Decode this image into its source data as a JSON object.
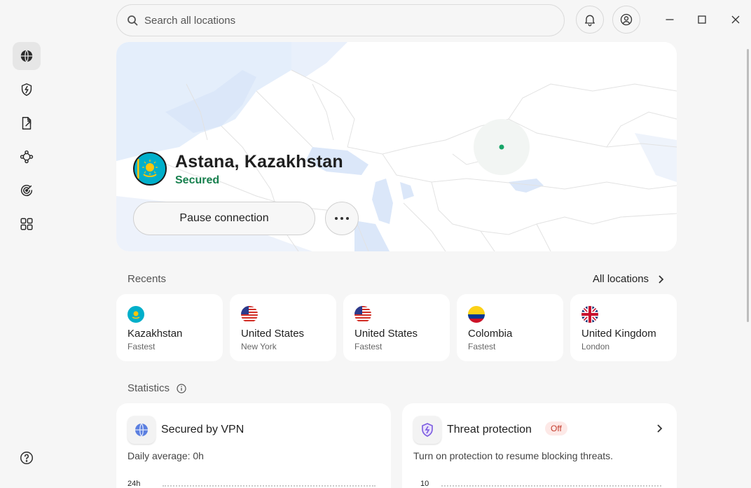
{
  "search": {
    "placeholder": "Search all locations"
  },
  "connection": {
    "location": "Astana, Kazakhstan",
    "status": "Secured",
    "pause_label": "Pause connection"
  },
  "recents": {
    "label": "Recents",
    "all_locations_label": "All locations",
    "items": [
      {
        "name": "Kazakhstan",
        "sub": "Fastest",
        "flag": "kazakhstan-flag"
      },
      {
        "name": "United States",
        "sub": "New York",
        "flag": "us-flag"
      },
      {
        "name": "United States",
        "sub": "Fastest",
        "flag": "us-flag"
      },
      {
        "name": "Colombia",
        "sub": "Fastest",
        "flag": "colombia-flag"
      },
      {
        "name": "United Kingdom",
        "sub": "London",
        "flag": "uk-flag"
      }
    ]
  },
  "statistics": {
    "label": "Statistics",
    "vpn": {
      "title": "Secured by VPN",
      "daily_label": "Daily average:",
      "daily_value": "0h",
      "axis_label": "24h"
    },
    "threat": {
      "title": "Threat protection",
      "badge": "Off",
      "description": "Turn on protection to resume blocking threats.",
      "axis_label": "10"
    }
  },
  "colors": {
    "accent_green": "#17804e",
    "badge_bg": "#fde9e7",
    "badge_text": "#c33b2b"
  }
}
